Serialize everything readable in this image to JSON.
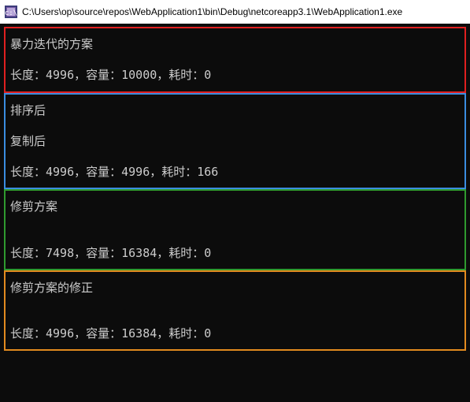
{
  "titlebar": {
    "path": "C:\\Users\\op\\source\\repos\\WebApplication1\\bin\\Debug\\netcoreapp3.1\\WebApplication1.exe"
  },
  "sections": {
    "s1": {
      "heading": "暴力迭代的方案",
      "stats": "长度：4996，容量：10000，耗时：0"
    },
    "s2": {
      "line1": "排序后",
      "line2": "复制后",
      "stats": "长度：4996，容量：4996，耗时：166"
    },
    "s3": {
      "heading": "修剪方案",
      "stats": "长度：7498，容量：16384，耗时：0"
    },
    "s4": {
      "heading": "修剪方案的修正",
      "stats": "长度：4996，容量：16384，耗时：0"
    }
  }
}
